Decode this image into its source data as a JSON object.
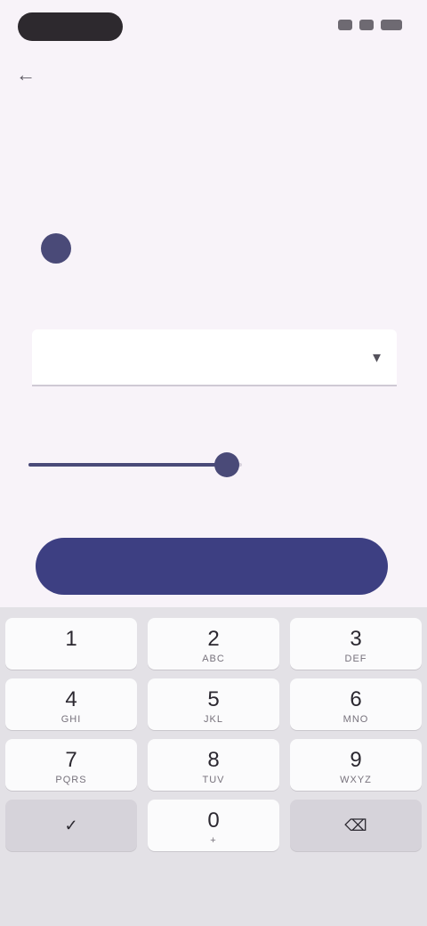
{
  "status_bar": {
    "time": "",
    "icons": [
      "signal-icon",
      "wifi-icon",
      "battery-icon"
    ]
  },
  "nav": {
    "back_icon": "arrow-back-icon",
    "back_glyph": "←"
  },
  "page": {
    "title": "",
    "info_icon_glyph": "",
    "info_text": ""
  },
  "field": {
    "label": "",
    "value": "",
    "placeholder": "",
    "dropdown_glyph": "▾",
    "helper": ""
  },
  "slider": {
    "value_fraction": 0.93,
    "caption": ""
  },
  "primary_button": {
    "label": ""
  },
  "keyboard": {
    "keys": [
      {
        "label": "1",
        "sub": ""
      },
      {
        "label": "2",
        "sub": "ABC"
      },
      {
        "label": "3",
        "sub": "DEF"
      },
      {
        "label": "4",
        "sub": "GHI"
      },
      {
        "label": "5",
        "sub": "JKL"
      },
      {
        "label": "6",
        "sub": "MNO"
      },
      {
        "label": "7",
        "sub": "PQRS"
      },
      {
        "label": "8",
        "sub": "TUV"
      },
      {
        "label": "9",
        "sub": "WXYZ"
      },
      {
        "label": "0",
        "sub": "+"
      }
    ],
    "backspace_glyph": "⌫",
    "done_glyph": "✓"
  },
  "colors": {
    "accent": "#3d3f82",
    "background": "#f8f3f9",
    "keyboard_bg": "#e3e1e6"
  }
}
